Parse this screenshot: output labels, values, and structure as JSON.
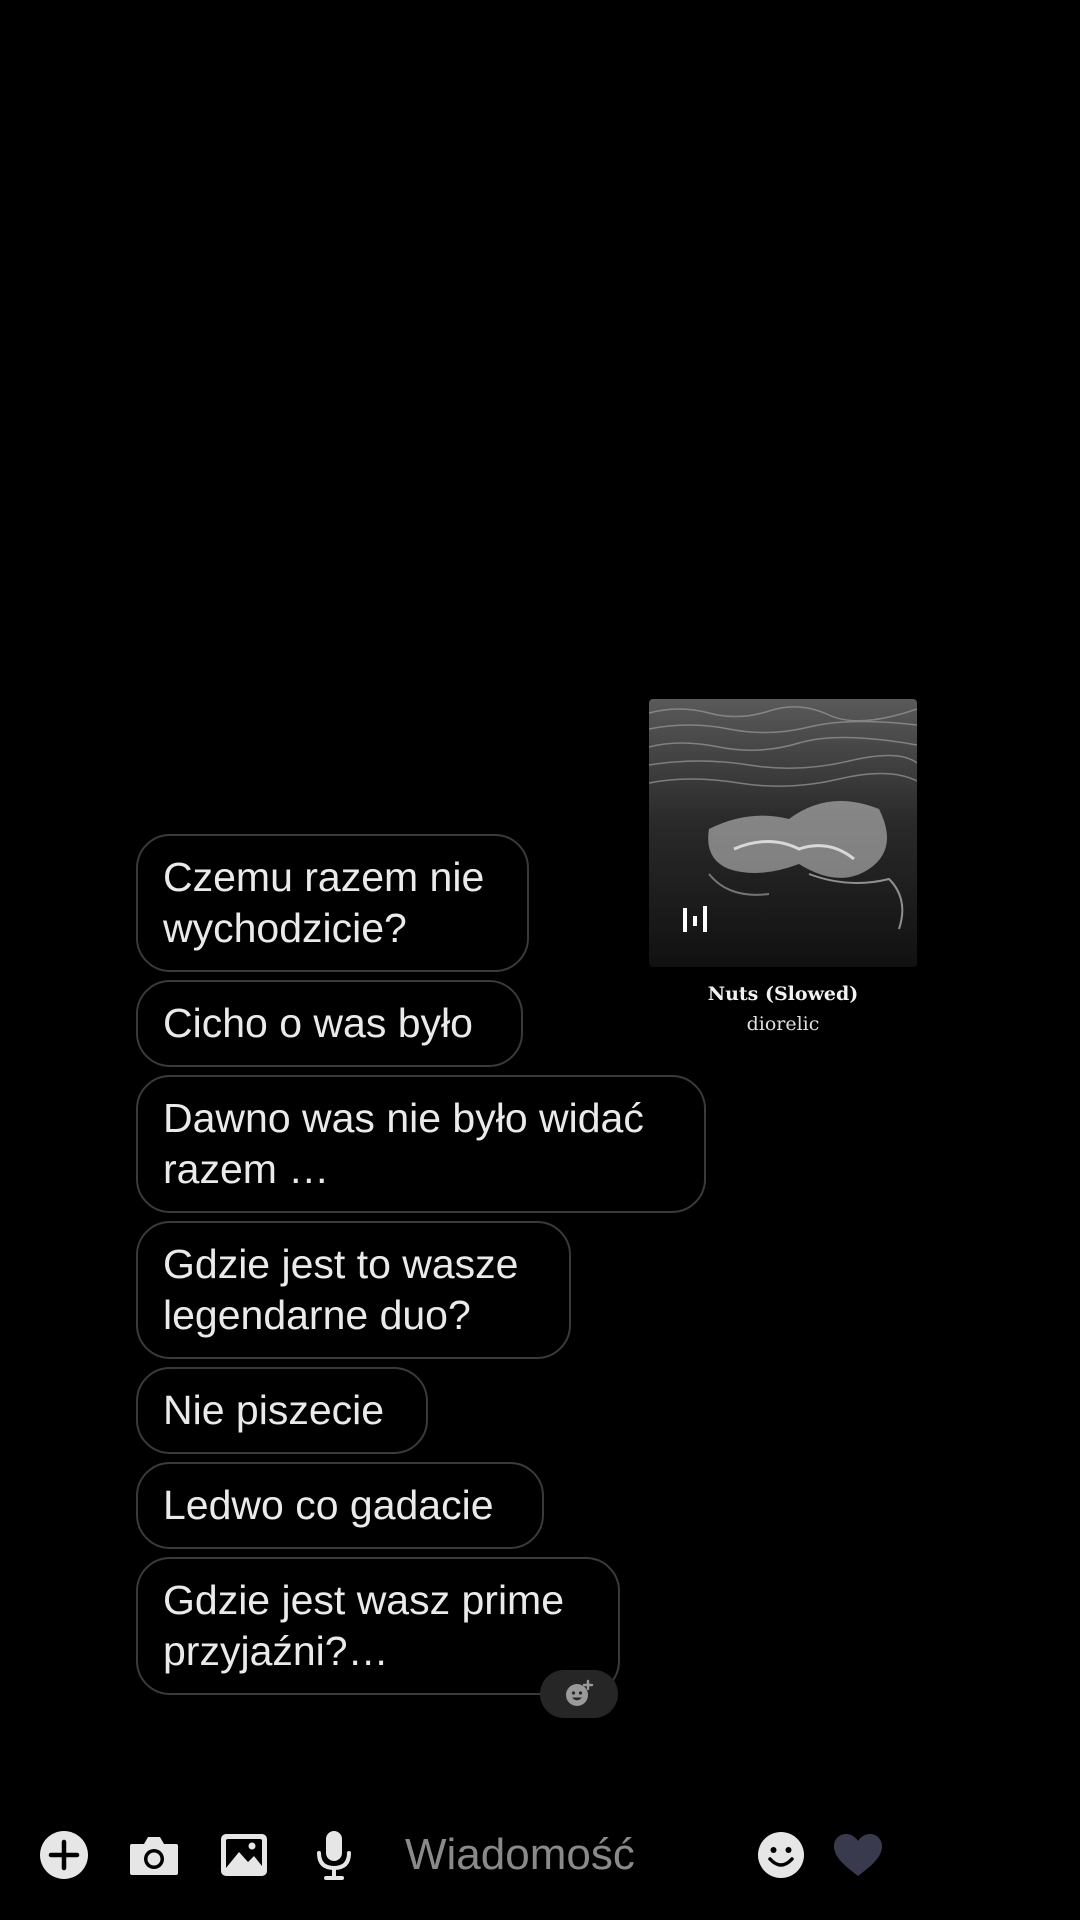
{
  "music": {
    "title": "Nuts (Slowed)",
    "artist": "diorelic",
    "artwork": "ocean-waves-image"
  },
  "messages": [
    {
      "text": "Czemu razem nie wychodzicie?"
    },
    {
      "text": "Cicho o was było"
    },
    {
      "text": "Dawno was nie było widać razem …"
    },
    {
      "text": "Gdzie jest to wasze legendarne duo?"
    },
    {
      "text": "Nie piszecie"
    },
    {
      "text": "Ledwo co gadacie"
    },
    {
      "text": "Gdzie jest wasz prime przyjaźni?…"
    }
  ],
  "reaction": {
    "icon": "add-reaction-icon"
  },
  "input_bar": {
    "placeholder": "Wiadomość",
    "icons": [
      "plus-icon",
      "camera-icon",
      "gallery-icon",
      "microphone-icon",
      "emoji-icon",
      "heart-icon"
    ]
  },
  "colors": {
    "background": "#000000",
    "bubble_border": "#3a3a3a",
    "text": "#eaeaea",
    "placeholder": "#8a8a8a",
    "heart": "#3a3a4e"
  }
}
